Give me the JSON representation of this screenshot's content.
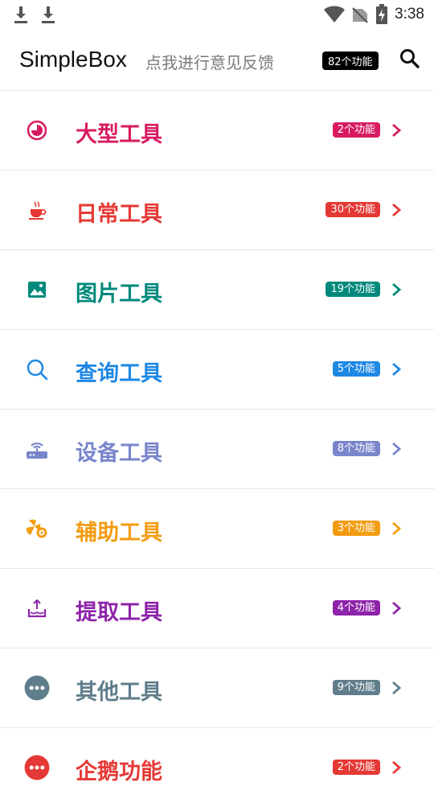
{
  "status_bar": {
    "time": "3:38"
  },
  "app_bar": {
    "title": "SimpleBox",
    "subtitle": "点我进行意见反馈",
    "count_badge": "82个功能"
  },
  "categories": [
    {
      "label": "大型工具",
      "badge": "2个功能",
      "color": "#d81b60",
      "icon": "pie-chart-icon"
    },
    {
      "label": "日常工具",
      "badge": "30个功能",
      "color": "#e53935",
      "icon": "coffee-cup-icon"
    },
    {
      "label": "图片工具",
      "badge": "19个功能",
      "color": "#00897b",
      "icon": "image-icon"
    },
    {
      "label": "查询工具",
      "badge": "5个功能",
      "color": "#1e88e5",
      "icon": "search-icon"
    },
    {
      "label": "设备工具",
      "badge": "8个功能",
      "color": "#7986cb",
      "icon": "router-icon"
    },
    {
      "label": "辅助工具",
      "badge": "3个功能",
      "color": "#f39c12",
      "icon": "fan-gear-icon"
    },
    {
      "label": "提取工具",
      "badge": "4个功能",
      "color": "#8e24aa",
      "icon": "extract-tray-icon"
    },
    {
      "label": "其他工具",
      "badge": "9个功能",
      "color": "#607d8b",
      "icon": "more-dots-icon"
    },
    {
      "label": "企鹅功能",
      "badge": "2个功能",
      "color": "#e53935",
      "icon": "penguin-icon"
    }
  ]
}
